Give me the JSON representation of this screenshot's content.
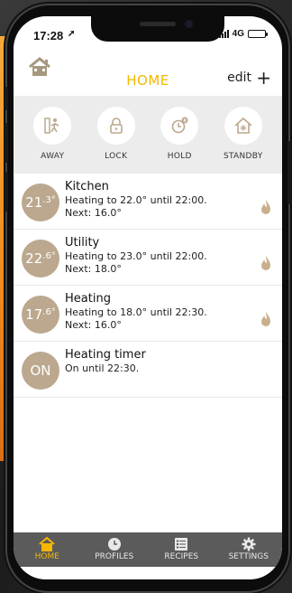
{
  "status_bar": {
    "time": "17:28",
    "network": "4G"
  },
  "header": {
    "title": "HOME",
    "edit_label": "edit",
    "add_label": "+"
  },
  "modes": [
    {
      "label": "AWAY",
      "icon": "walking-person-icon"
    },
    {
      "label": "LOCK",
      "icon": "padlock-icon"
    },
    {
      "label": "HOLD",
      "icon": "clock-pause-icon"
    },
    {
      "label": "STANDBY",
      "icon": "house-snowflake-icon"
    }
  ],
  "zones": [
    {
      "temp_int": "21",
      "temp_dec": ".3°",
      "name": "Kitchen",
      "line1": "Heating to 22.0° until 22:00.",
      "line2": "Next:  16.0°",
      "flame": true
    },
    {
      "temp_int": "22",
      "temp_dec": ".6°",
      "name": "Utility",
      "line1": "Heating to 23.0° until 22:00.",
      "line2": "Next:  18.0°",
      "flame": true
    },
    {
      "temp_int": "17",
      "temp_dec": ".6°",
      "name": "Heating",
      "line1": "Heating to 18.0° until 22:30.",
      "line2": "Next:  16.0°",
      "flame": true
    },
    {
      "temp_int": "ON",
      "temp_dec": "",
      "name": "Heating timer",
      "line1": "On until 22:30.",
      "line2": "",
      "flame": false
    }
  ],
  "tabs": [
    {
      "label": "HOME",
      "icon": "house-icon",
      "active": true
    },
    {
      "label": "PROFILES",
      "icon": "clock-icon",
      "active": false
    },
    {
      "label": "RECIPES",
      "icon": "list-icon",
      "active": false
    },
    {
      "label": "SETTINGS",
      "icon": "gear-icon",
      "active": false
    }
  ],
  "colors": {
    "accent": "#f5b800",
    "circle": "#bba88e",
    "flame": "#c9b08a",
    "tabbar": "#5b5b5b",
    "mode_band": "#ececec"
  }
}
